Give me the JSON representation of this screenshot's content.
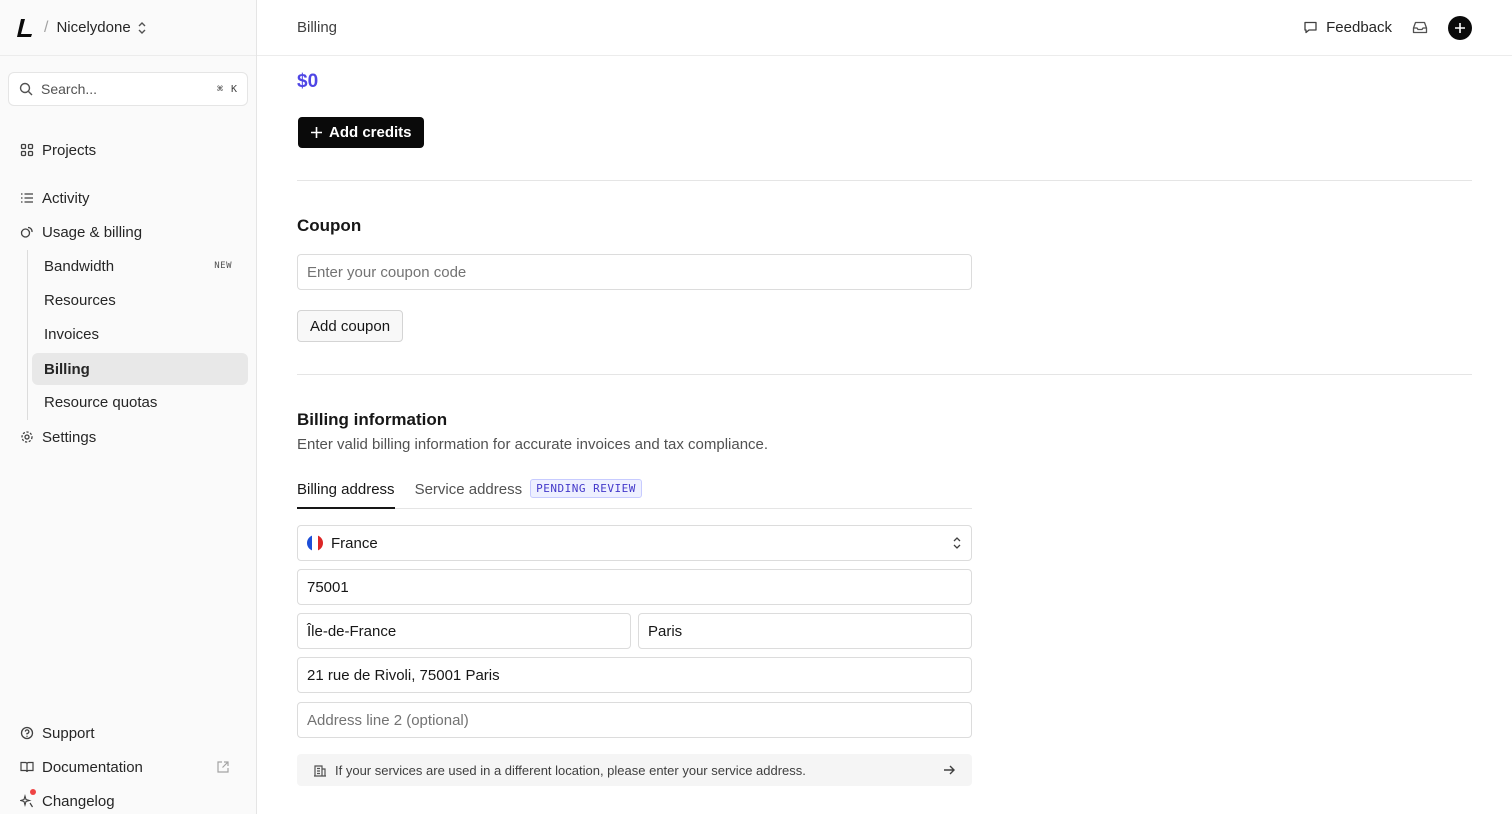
{
  "sidebar": {
    "team": "Nicelydone",
    "search": {
      "placeholder": "Search...",
      "kbd_cmd": "⌘",
      "kbd_key": "K"
    },
    "nav": {
      "projects": "Projects",
      "activity": "Activity",
      "usage_billing": "Usage & billing",
      "settings": "Settings",
      "support": "Support",
      "documentation": "Documentation",
      "changelog": "Changelog"
    },
    "sub": {
      "bandwidth": "Bandwidth",
      "bandwidth_badge": "NEW",
      "resources": "Resources",
      "invoices": "Invoices",
      "billing": "Billing",
      "resource_quotas": "Resource quotas"
    }
  },
  "header": {
    "title": "Billing",
    "feedback": "Feedback"
  },
  "credits": {
    "amount": "$0",
    "add_label": "Add credits"
  },
  "coupon": {
    "title": "Coupon",
    "placeholder": "Enter your coupon code",
    "button": "Add coupon"
  },
  "billing_info": {
    "title": "Billing information",
    "description": "Enter valid billing information for accurate invoices and tax compliance.",
    "tabs": {
      "billing_address": "Billing address",
      "service_address": "Service address",
      "pending": "PENDING REVIEW"
    },
    "country": "France",
    "postal_code": "75001",
    "region": "Île-de-France",
    "city": "Paris",
    "address_line1": "21 rue de Rivoli, 75001 Paris",
    "address_line2_placeholder": "Address line 2 (optional)",
    "service_notice": "If your services are used in a different location, please enter your service address."
  },
  "colors": {
    "accent": "#4f46e5",
    "primary_button": "#0a0a0a",
    "pending_badge": "#4338ca",
    "notification_dot": "#ef4444"
  }
}
